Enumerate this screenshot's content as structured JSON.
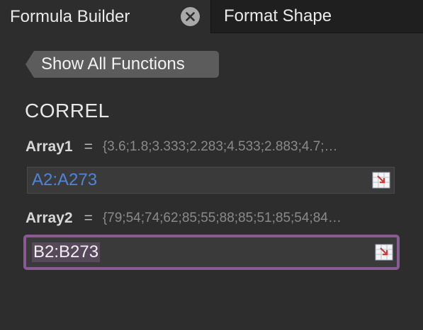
{
  "tabs": {
    "active_label": "Formula Builder",
    "inactive_label": "Format Shape"
  },
  "toolbar": {
    "back_label": "Show All Functions"
  },
  "function": {
    "name": "CORREL"
  },
  "arguments": [
    {
      "label": "Array1",
      "equals": "=",
      "preview": "{3.6;1.8;3.333;2.283;4.533;2.883;4.7;…",
      "value": "A2:A273"
    },
    {
      "label": "Array2",
      "equals": "=",
      "preview": "{79;54;74;62;85;55;88;85;51;85;54;84…",
      "value": "B2:B273"
    }
  ],
  "colors": {
    "background": "#2d2d2d",
    "reference_text": "#4f84d9",
    "focus_border": "#8a5a93"
  },
  "icons": {
    "close": "close-icon",
    "back": "back-arrow-button",
    "range_select": "range-select-icon"
  }
}
